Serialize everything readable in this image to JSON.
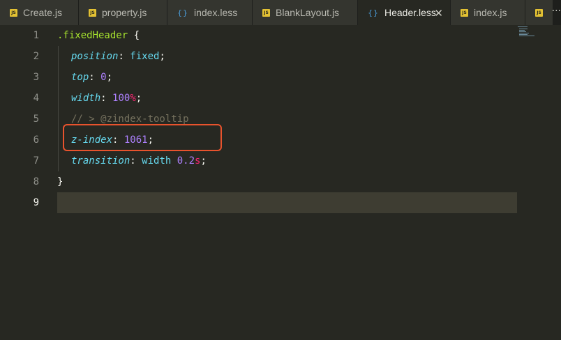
{
  "tabs": [
    {
      "label": "Create.js",
      "icon": "js-file-icon",
      "icon_text": "JS"
    },
    {
      "label": "property.js",
      "icon": "js-file-icon",
      "icon_text": "JS"
    },
    {
      "label": "index.less",
      "icon": "less-file-icon",
      "icon_text": "{}"
    },
    {
      "label": "BlankLayout.js",
      "icon": "js-file-icon",
      "icon_text": "JS"
    },
    {
      "label": "Header.less",
      "icon": "less-file-icon",
      "icon_text": "{}",
      "active": true,
      "close": "✕"
    },
    {
      "label": "index.js",
      "icon": "js-file-icon",
      "icon_text": "JS"
    },
    {
      "label": "",
      "icon": "js-file-icon",
      "icon_text": "JS"
    }
  ],
  "tab_overflow": "···",
  "editor": {
    "line_numbers": [
      "1",
      "2",
      "3",
      "4",
      "5",
      "6",
      "7",
      "8",
      "9"
    ],
    "current_line": 9,
    "lines": [
      {
        "selector": ".fixedHeader",
        "brace": " {"
      },
      {
        "prop": "position",
        "colon": ": ",
        "value": "fixed",
        "semi": ";"
      },
      {
        "prop": "top",
        "colon": ": ",
        "number": "0",
        "semi": ";"
      },
      {
        "prop": "width",
        "colon": ": ",
        "number": "100",
        "unit": "%",
        "semi": ";"
      },
      {
        "comment": "// > @zindex-tooltip"
      },
      {
        "prop": "z-index",
        "colon": ": ",
        "number": "1061",
        "semi": ";"
      },
      {
        "prop": "transition",
        "colon": ": ",
        "value": "width",
        "space": " ",
        "number": "0.2",
        "unit": "s",
        "semi": ";"
      },
      {
        "brace": "}"
      },
      {}
    ]
  },
  "colors": {
    "background": "#272822",
    "highlight_box": "#e8532d",
    "selector": "#a6e22e",
    "property": "#66d9ef",
    "number": "#ae81ff",
    "unit": "#f92672",
    "comment": "#75715e"
  }
}
